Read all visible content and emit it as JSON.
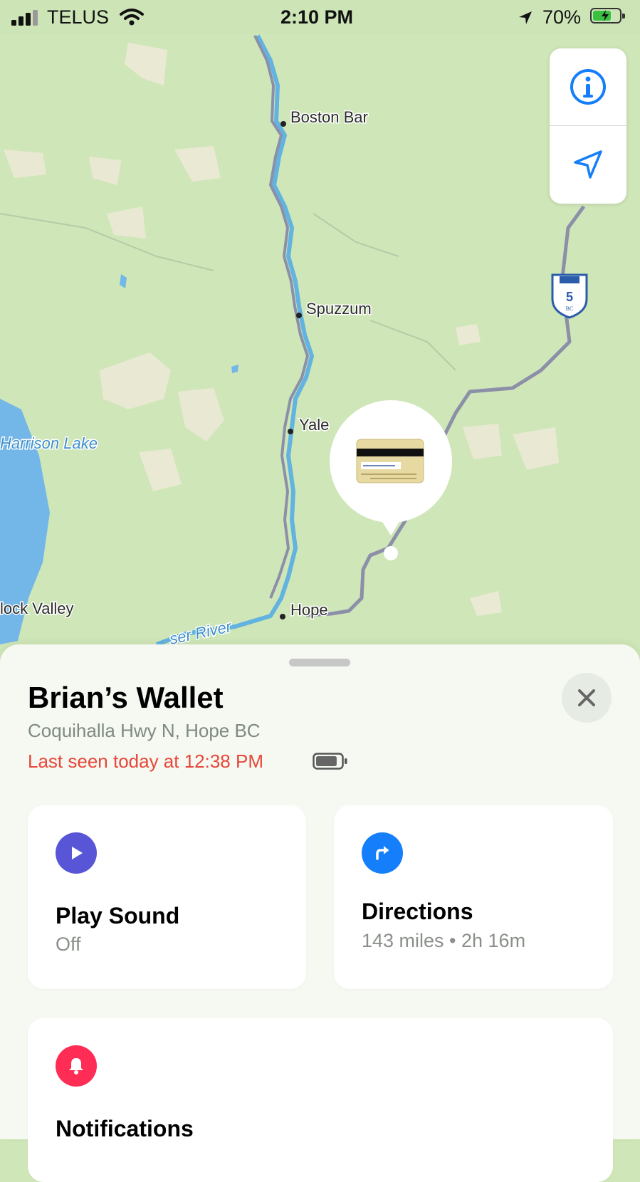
{
  "status_bar": {
    "carrier": "TELUS",
    "time": "2:10 PM",
    "battery_text": "70%",
    "battery_level": 0.7
  },
  "map": {
    "places": {
      "boston_bar": "Boston Bar",
      "spuzzum": "Spuzzum",
      "yale": "Yale",
      "hope": "Hope",
      "harrison_lake": "Harrison Lake",
      "rock_valley": "lock Valley",
      "fraser_river": "ser River"
    },
    "highway_shield": {
      "number": "5",
      "region": "BC"
    },
    "pin_item_icon": "credit-card-icon"
  },
  "map_controls": {
    "info_icon": "info-icon",
    "location_icon": "location-arrow-icon"
  },
  "item": {
    "name": "Brian’s Wallet",
    "address": "Coquihalla Hwy N, Hope BC",
    "last_seen": "Last seen today at 12:38 PM",
    "battery_level": 0.85
  },
  "actions": {
    "play_sound": {
      "title": "Play Sound",
      "subtitle": "Off",
      "icon": "play-icon",
      "color": "#5856d6"
    },
    "directions": {
      "title": "Directions",
      "subtitle": "143 miles • 2h 16m",
      "icon": "directions-arrow-icon",
      "color": "#147efb"
    },
    "notifications": {
      "title": "Notifications",
      "icon": "bell-icon",
      "color": "#ff2d55"
    }
  },
  "colors": {
    "map_land": "#cfe6b8",
    "water": "#73b7e8",
    "road": "#8b8fa8",
    "accent_blue": "#147efb",
    "alert_red": "#e8463a"
  }
}
